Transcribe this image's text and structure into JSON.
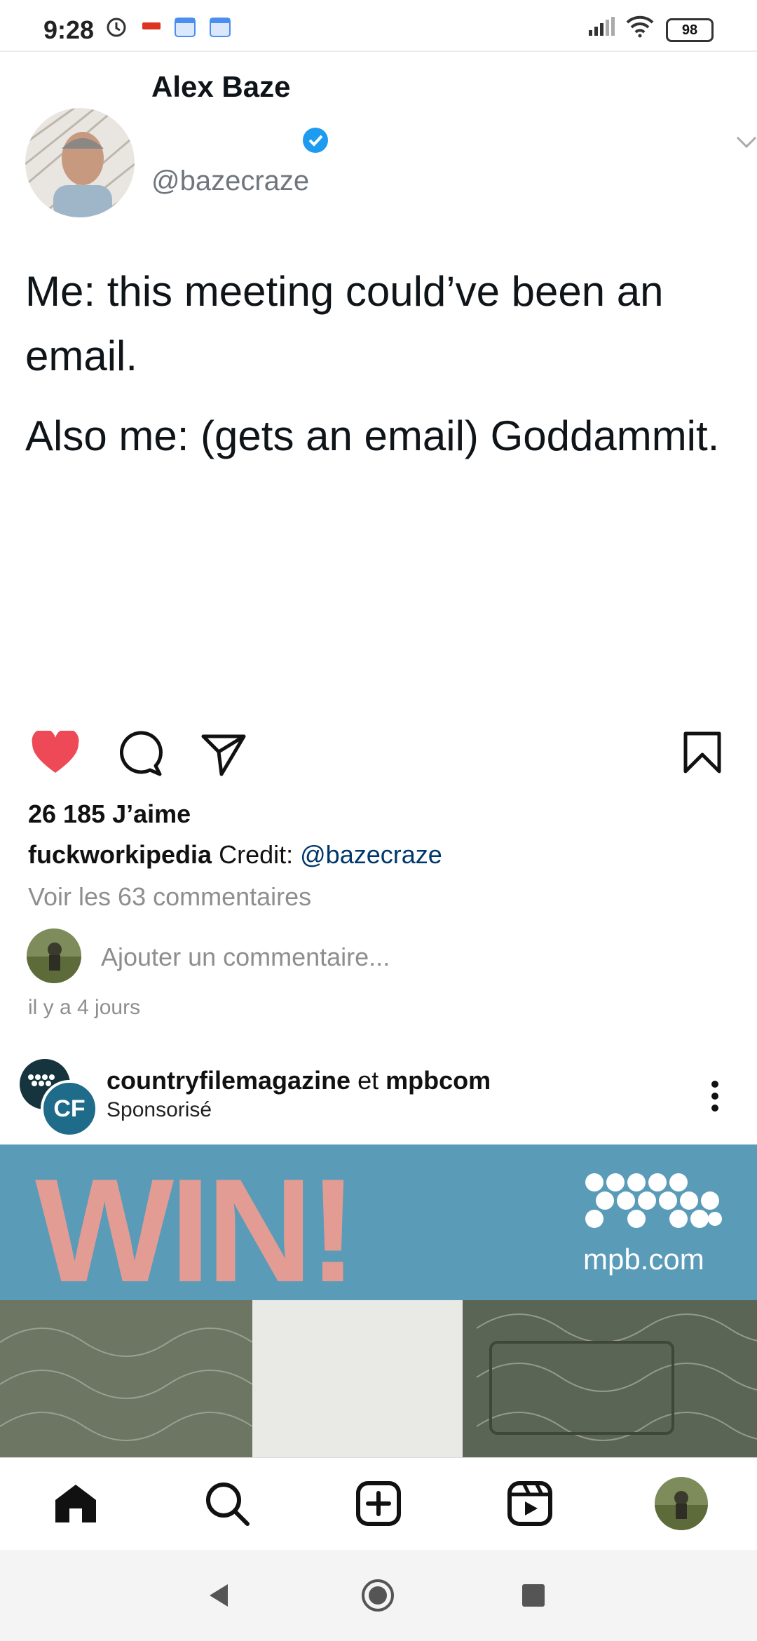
{
  "status_bar": {
    "time": "9:28",
    "battery": "98"
  },
  "tweet": {
    "name": "Alex Baze",
    "handle": "@bazecraze",
    "line1": "Me: this meeting could’ve been an email.",
    "line2": "Also me: (gets an email) Goddammit."
  },
  "post": {
    "likes": "26 185 J’aime",
    "caption_user": "fuckworkipedia",
    "caption_text": "Credit:",
    "caption_mention": "@bazecraze",
    "view_comments": "Voir les 63 commentaires",
    "add_comment_placeholder": "Ajouter un commentaire...",
    "time_ago": "il y a 4 jours"
  },
  "sponsored": {
    "account1": "countryfilemagazine",
    "joiner": "et",
    "account2": "mpbcom",
    "subtitle": "Sponsorisé",
    "badge": "CF",
    "ad_headline": "WIN!",
    "ad_url": "mpb.com"
  },
  "icons": {
    "like": "heart-icon",
    "comment": "comment-icon",
    "share": "send-icon",
    "save": "bookmark-icon",
    "home": "home-icon",
    "search": "search-icon",
    "create": "plus-square-icon",
    "reels": "reels-icon"
  },
  "colors": {
    "like_red": "#ed4956",
    "mention_blue": "#00376b",
    "verified_blue": "#1d9bf0",
    "ad_blue": "#5a9bb8",
    "ad_pink": "#e39c93"
  }
}
